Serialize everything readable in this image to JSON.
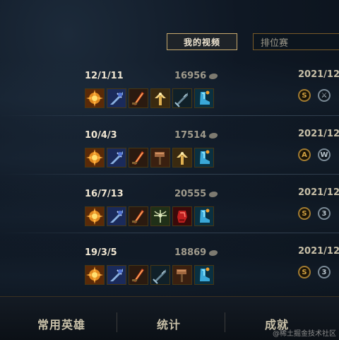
{
  "header": {
    "videos_button": "我的视频",
    "queue_select_value": "排位赛"
  },
  "matches": [
    {
      "kda": "12/1/11",
      "gold": "16956",
      "date": "2021/12",
      "items": [
        "sunfire-item-icon",
        "spear-item-icon",
        "blade-item-icon",
        "angel-item-icon",
        "sword-item-icon",
        "boots-item-icon"
      ],
      "badges": [
        {
          "letter": "S",
          "style": "gold"
        },
        {
          "letter": "⚔",
          "style": "silver"
        }
      ]
    },
    {
      "kda": "10/4/3",
      "gold": "17514",
      "date": "2021/12",
      "items": [
        "sunfire-item-icon",
        "spear-item-icon",
        "blade-item-icon",
        "hammer-item-icon",
        "angel-item-icon",
        "boots-item-icon"
      ],
      "badges": [
        {
          "letter": "A",
          "style": "gold"
        },
        {
          "letter": "W",
          "style": "silver"
        }
      ]
    },
    {
      "kda": "16/7/13",
      "gold": "20555",
      "date": "2021/12",
      "items": [
        "sunfire-item-icon",
        "spear-item-icon",
        "blade-item-icon",
        "crossbow-item-icon",
        "gauntlet-item-icon",
        "boots-item-icon"
      ],
      "badges": [
        {
          "letter": "S",
          "style": "gold"
        },
        {
          "letter": "3",
          "style": "silver"
        }
      ]
    },
    {
      "kda": "19/3/5",
      "gold": "18869",
      "date": "2021/12",
      "items": [
        "sunfire-item-icon",
        "spear-item-icon",
        "blade-item-icon",
        "sword-item-icon",
        "hammer-item-icon",
        "boots-item-icon"
      ],
      "badges": [
        {
          "letter": "S",
          "style": "gold"
        },
        {
          "letter": "3",
          "style": "silver"
        }
      ]
    }
  ],
  "bottom_tabs": [
    "常用英雄",
    "统计",
    "成就"
  ],
  "watermark": "@稀土掘金技术社区",
  "colors": {
    "accent_gold": "#c8aa6e",
    "background": "#0f1824",
    "text_light": "#f0e6d2"
  }
}
